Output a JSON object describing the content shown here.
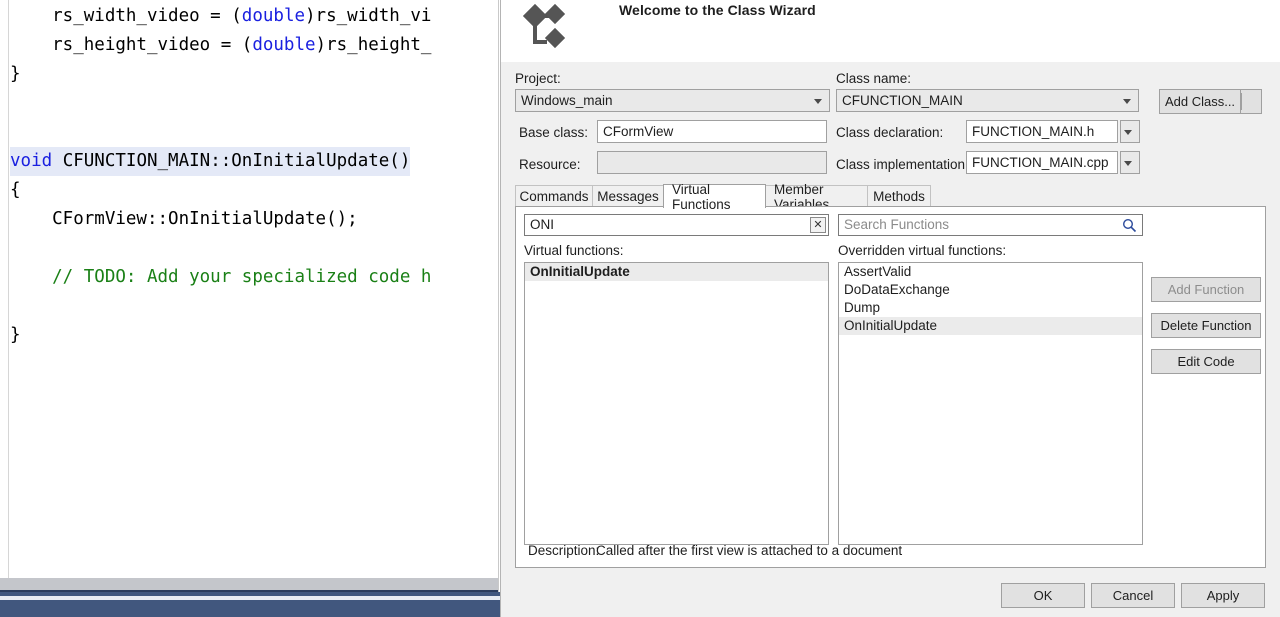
{
  "editor": {
    "lines": [
      {
        "segments": [
          {
            "t": "    rs_width_video = (",
            "c": "plain"
          },
          {
            "t": "double",
            "c": "kw"
          },
          {
            "t": ")rs_width_vi",
            "c": "plain"
          }
        ]
      },
      {
        "segments": [
          {
            "t": "    rs_height_video = (",
            "c": "plain"
          },
          {
            "t": "double",
            "c": "kw"
          },
          {
            "t": ")rs_height_",
            "c": "plain"
          }
        ]
      },
      {
        "segments": [
          {
            "t": "}",
            "c": "plain"
          }
        ]
      },
      {
        "segments": [
          {
            "t": "",
            "c": "plain"
          }
        ]
      },
      {
        "segments": [
          {
            "t": "",
            "c": "plain"
          }
        ]
      },
      {
        "segments": [
          {
            "t": "void",
            "c": "kw-hl"
          },
          {
            "t": " CFUNCTION_MAIN::OnInitialUpdate()",
            "c": "plain-hl"
          }
        ]
      },
      {
        "segments": [
          {
            "t": "{",
            "c": "plain"
          }
        ]
      },
      {
        "segments": [
          {
            "t": "    CFormView::OnInitialUpdate();",
            "c": "plain"
          }
        ]
      },
      {
        "segments": [
          {
            "t": "",
            "c": "plain"
          }
        ]
      },
      {
        "segments": [
          {
            "t": "    // TODO: Add your specialized code h",
            "c": "cmt"
          }
        ]
      },
      {
        "segments": [
          {
            "t": "",
            "c": "plain"
          }
        ]
      },
      {
        "segments": [
          {
            "t": "}",
            "c": "plain"
          }
        ]
      }
    ]
  },
  "dialog": {
    "title": "Welcome to the Class Wizard",
    "icon": "class-wizard-icon",
    "fields": {
      "project_label": "Project:",
      "project_value": "Windows_main",
      "base_class_label": "Base class:",
      "base_class_value": "CFormView",
      "resource_label": "Resource:",
      "resource_value": "",
      "class_name_label": "Class name:",
      "class_name_value": "CFUNCTION_MAIN",
      "class_declaration_label": "Class declaration:",
      "class_declaration_value": "FUNCTION_MAIN.h",
      "class_implementation_label": "Class implementation:",
      "class_implementation_value": "FUNCTION_MAIN.cpp"
    },
    "add_class_button": "Add Class...",
    "tabs": [
      {
        "label": "Commands",
        "active": false
      },
      {
        "label": "Messages",
        "active": false
      },
      {
        "label": "Virtual Functions",
        "active": true
      },
      {
        "label": "Member Variables",
        "active": false
      },
      {
        "label": "Methods",
        "active": false
      }
    ],
    "filter": {
      "value": "ONI",
      "clear_glyph": "✕"
    },
    "search": {
      "placeholder": "Search Functions"
    },
    "virtual_functions": {
      "label": "Virtual functions:",
      "items": [
        {
          "name": "OnInitialUpdate",
          "selected": true
        }
      ]
    },
    "overridden_functions": {
      "label": "Overridden virtual functions:",
      "items": [
        {
          "name": "AssertValid",
          "selected": false
        },
        {
          "name": "DoDataExchange",
          "selected": false
        },
        {
          "name": "Dump",
          "selected": false
        },
        {
          "name": "OnInitialUpdate",
          "selected": true
        }
      ]
    },
    "side_buttons": [
      {
        "label": "Add Function",
        "disabled": true
      },
      {
        "label": "Delete Function",
        "disabled": false
      },
      {
        "label": "Edit Code",
        "disabled": false
      }
    ],
    "description": {
      "label": "Description:",
      "text": "Called after the first view is attached to a document"
    },
    "footer_buttons": [
      {
        "label": "OK"
      },
      {
        "label": "Cancel"
      },
      {
        "label": "Apply"
      }
    ]
  },
  "colors": {
    "dialog_bg": "#f0f0f0",
    "panel_bg": "#ffffff",
    "keyword_blue": "#1a20e0",
    "comment_green": "#1a8016",
    "selection_gray": "#ebebeb",
    "code_highlight": "#e4e9f7",
    "statusbar_blue": "#41577e"
  }
}
